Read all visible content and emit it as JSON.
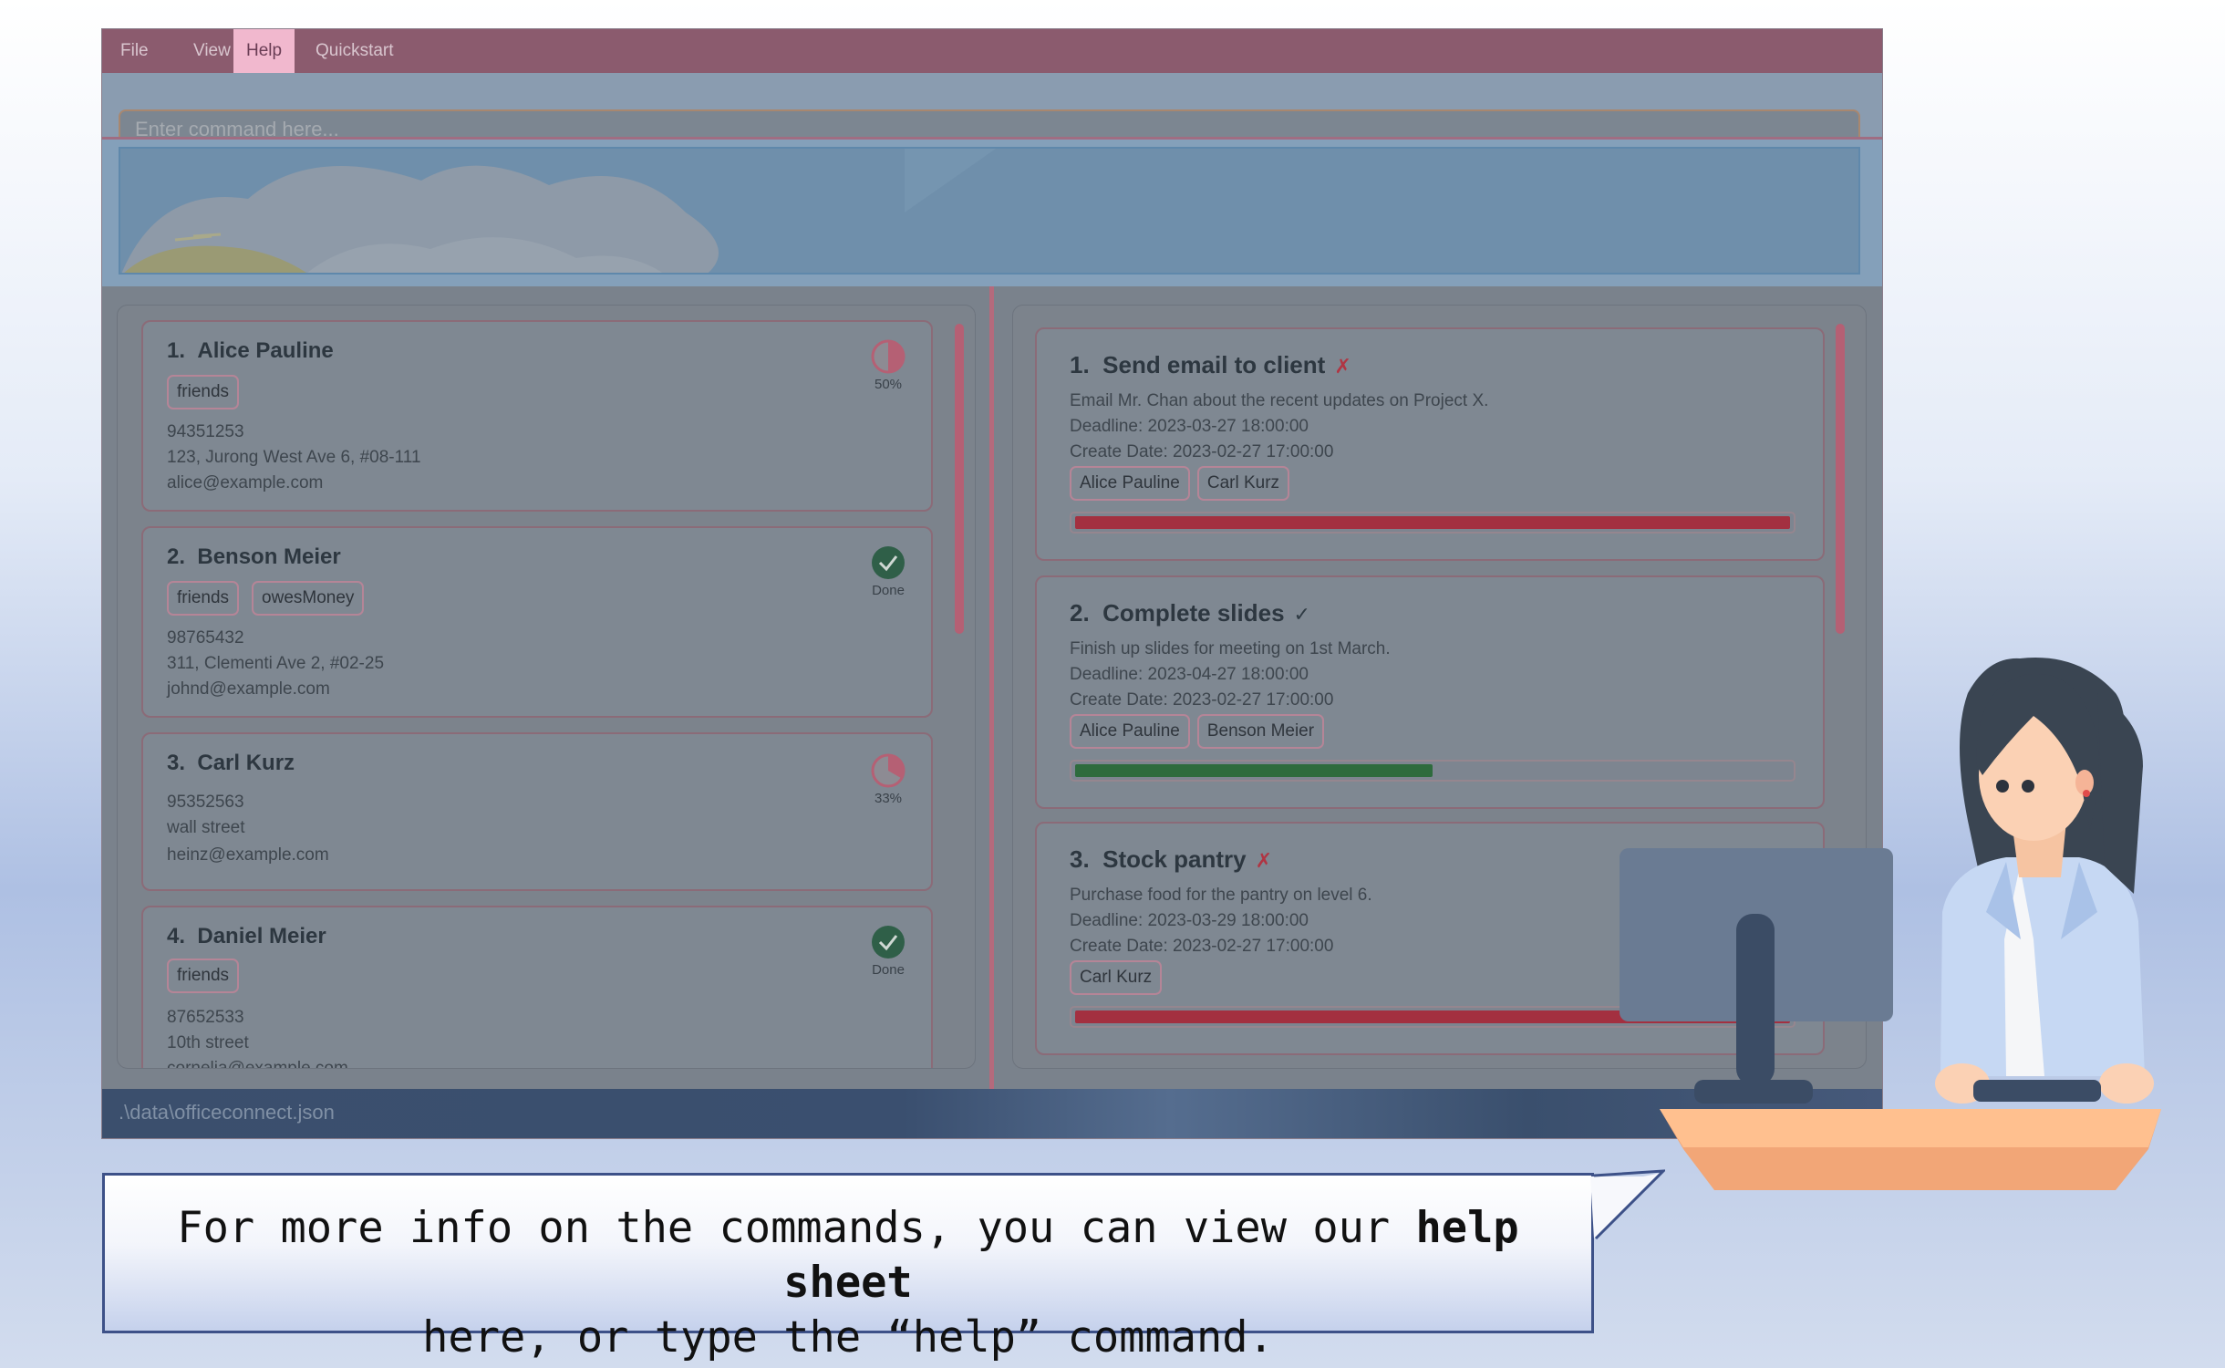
{
  "menu": {
    "items": [
      {
        "label": "File"
      },
      {
        "label": "View"
      },
      {
        "label": "Help"
      },
      {
        "label": "Quickstart"
      }
    ],
    "active": "Help"
  },
  "command_box": {
    "placeholder": "Enter command here..."
  },
  "persons": [
    {
      "index": "1.",
      "name": "Alice Pauline",
      "tags": [
        "friends"
      ],
      "phone": "94351253",
      "address": "123, Jurong West Ave 6, #08-111",
      "email": "alice@example.com",
      "status": "50%",
      "status_icon": "half-pie-icon",
      "progress": 0.5
    },
    {
      "index": "2.",
      "name": "Benson Meier",
      "tags": [
        "friends",
        "owesMoney"
      ],
      "phone": "98765432",
      "address": "311, Clementi Ave 2, #02-25",
      "email": "johnd@example.com",
      "status": "Done",
      "status_icon": "check-circle-icon",
      "progress": 1.0
    },
    {
      "index": "3.",
      "name": "Carl Kurz",
      "tags": [],
      "phone": "95352563",
      "address": "wall street",
      "email": "heinz@example.com",
      "status": "33%",
      "status_icon": "third-pie-icon",
      "progress": 0.33
    },
    {
      "index": "4.",
      "name": "Daniel Meier",
      "tags": [
        "friends"
      ],
      "phone": "87652533",
      "address": "10th street",
      "email": "cornelia@example.com",
      "status": "Done",
      "status_icon": "check-circle-icon",
      "progress": 1.0
    }
  ],
  "tasks": [
    {
      "index": "1.",
      "title": "Send email to client",
      "mark": "✗",
      "done": false,
      "description": "Email Mr. Chan about the recent updates on Project X.",
      "deadline": "Deadline: 2023-03-27 18:00:00",
      "created": "Create Date: 2023-02-27 17:00:00",
      "assignees": [
        "Alice Pauline",
        "Carl Kurz"
      ],
      "progress": 1.0,
      "progress_color": "#a33040"
    },
    {
      "index": "2.",
      "title": "Complete slides",
      "mark": "✓",
      "done": true,
      "description": "Finish up slides for meeting on 1st March.",
      "deadline": "Deadline: 2023-04-27 18:00:00",
      "created": "Create Date: 2023-02-27 17:00:00",
      "assignees": [
        "Alice Pauline",
        "Benson Meier"
      ],
      "progress": 0.5,
      "progress_color": "#2e6b3d"
    },
    {
      "index": "3.",
      "title": "Stock pantry",
      "mark": "✗",
      "done": false,
      "description": "Purchase food for the pantry on level 6.",
      "deadline": "Deadline: 2023-03-29 18:00:00",
      "created": "Create Date: 2023-02-27 17:00:00",
      "assignees": [
        "Carl Kurz"
      ],
      "progress": 1.0,
      "progress_color": "#a33040"
    }
  ],
  "status_bar": {
    "path": ".\\data\\officeconnect.json"
  },
  "bubble": {
    "line1_pre": "For more info on the commands, you can view our ",
    "line1_bold": "help sheet",
    "line2": "here, or type the “help” command."
  },
  "colors": {
    "menubar": "#8b5b6e",
    "active_menu": "#f1b8ce",
    "accent_pink": "#b56074",
    "task_incomplete": "#a33040",
    "task_progress": "#2e6b3d"
  }
}
